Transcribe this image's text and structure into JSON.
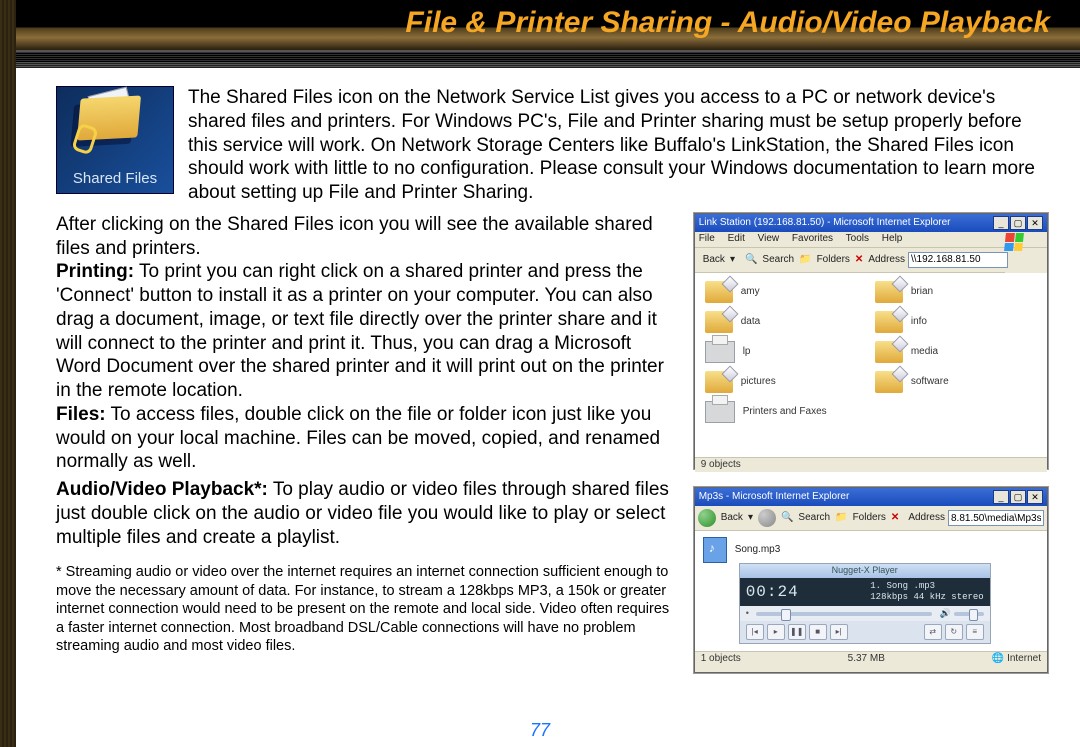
{
  "title": "File & Printer Sharing - Audio/Video Playback",
  "shared_icon_label": "Shared Files",
  "intro": "The Shared Files icon on the Network Service List gives you access to a PC or network device's shared files and printers.  For Windows PC's, File and Printer sharing must be setup properly before this service will work.  On Network Storage Centers like Buffalo's LinkStation, the Shared Files icon should work with little to no configuration.  Please consult your Windows documentation to learn more about setting up File and Printer Sharing.",
  "p1": "After clicking on the Shared Files icon you will see the available shared files and printers.",
  "printing_label": "Printing:",
  "printing_body": "  To print you can right click on a shared printer and press the 'Connect' button to install it as a printer on your computer.  You can also drag a document, image, or text file directly over the printer share and it will connect to the printer and print it.  Thus, you can drag a Microsoft Word Document over the shared printer and it will print out on the printer in the remote location.",
  "files_label": "Files:",
  "files_body": "  To access files, double click on the file or folder icon just like you would on your local machine.  Files can be moved, copied, and renamed normally as well.",
  "av_label": "Audio/Video Playback*:",
  "av_body": "  To play audio or video files through shared files just double click on the audio or video file you would like to play or select multiple files and create a playlist.",
  "footnote": "* Streaming audio or video over the internet requires an internet connection sufficient enough to move the necessary amount of data.  For instance, to stream a 128kbps MP3, a 150k or greater internet connection would need to be present on the remote and local side.  Video often requires a faster internet connection.  Most broadband DSL/Cable connections will have no problem streaming audio and most video files.",
  "page_number": "77",
  "win1": {
    "title": "Link Station (192.168.81.50) - Microsoft Internet Explorer",
    "menu": {
      "file": "File",
      "edit": "Edit",
      "view": "View",
      "fav": "Favorites",
      "tools": "Tools",
      "help": "Help"
    },
    "toolbar": {
      "back": "Back",
      "search": "Search",
      "folders": "Folders",
      "address_label": "Address",
      "address_value": "\\\\192.168.81.50"
    },
    "items": [
      {
        "type": "folder",
        "name": "amy"
      },
      {
        "type": "folder",
        "name": "brian"
      },
      {
        "type": "folder",
        "name": "data"
      },
      {
        "type": "folder",
        "name": "info"
      },
      {
        "type": "printer",
        "name": "lp"
      },
      {
        "type": "folder",
        "name": "media"
      },
      {
        "type": "folder",
        "name": "pictures"
      },
      {
        "type": "folder",
        "name": "software"
      },
      {
        "type": "printer",
        "name": "Printers and Faxes"
      }
    ],
    "status": "9 objects"
  },
  "win2": {
    "title": "Mp3s - Microsoft Internet Explorer",
    "toolbar": {
      "back": "Back",
      "search": "Search",
      "folders": "Folders",
      "address_label": "Address",
      "address_value": "8.81.50\\media\\Mp3s"
    },
    "file": "Song.mp3",
    "player": {
      "name": "Nugget-X Player",
      "time": "00:24",
      "track": "1. Song .mp3",
      "bitrate": "128kbps",
      "rate": "44 kHz",
      "mode": "stereo"
    },
    "status_left": "1 objects",
    "status_mid": "5.37 MB",
    "status_right": "Internet"
  }
}
